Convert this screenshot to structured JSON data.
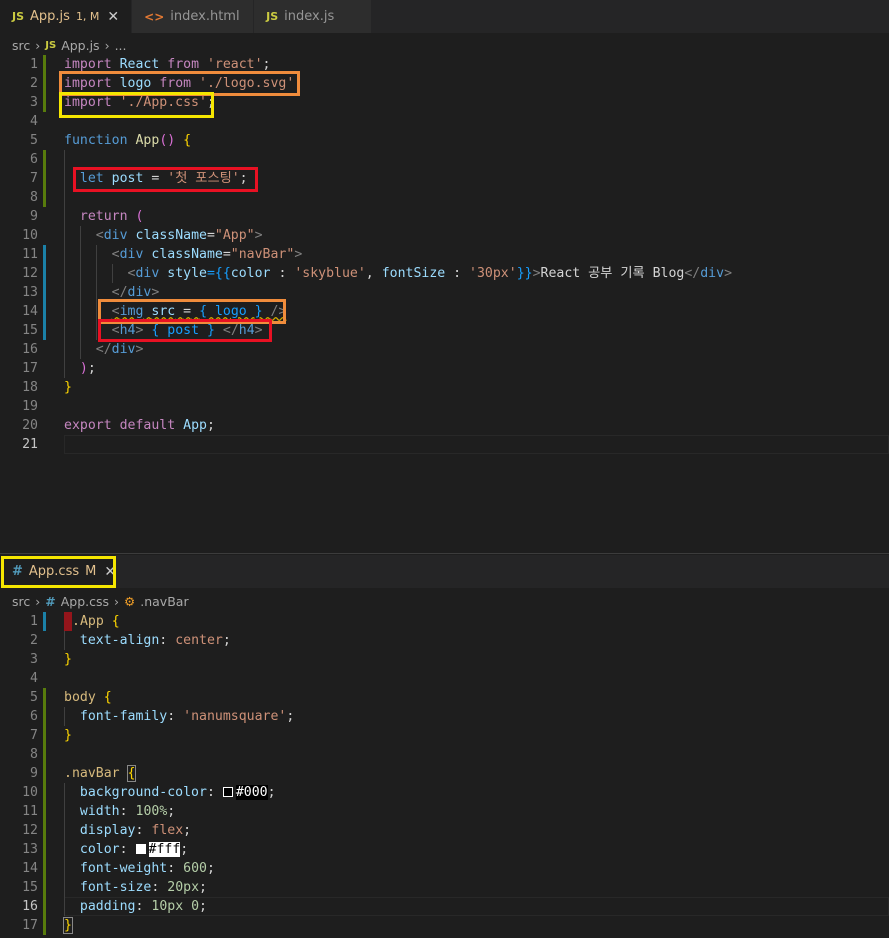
{
  "top_tabs": [
    {
      "icon": "JS",
      "name": "App.js",
      "status": "1, M",
      "active": true
    },
    {
      "icon": "<>",
      "name": "index.html",
      "status": "",
      "active": false
    },
    {
      "icon": "JS",
      "name": "index.js",
      "status": "",
      "active": false
    }
  ],
  "top_breadcrumb": {
    "folder": "src",
    "icon": "JS",
    "file": "App.js",
    "more": "..."
  },
  "top_line_numbers": [
    "1",
    "2",
    "3",
    "4",
    "5",
    "6",
    "7",
    "8",
    "9",
    "10",
    "11",
    "12",
    "13",
    "14",
    "15",
    "16",
    "17",
    "18",
    "19",
    "20",
    "21"
  ],
  "top_code": {
    "l1": [
      "import",
      "React",
      "from",
      "'react'",
      ";"
    ],
    "l2": [
      "import",
      "logo",
      "from",
      "'./logo.svg'",
      ";"
    ],
    "l3": [
      "import",
      "'./App.css'",
      ";"
    ],
    "l5": [
      "function",
      "App",
      "()",
      "{"
    ],
    "l7": [
      "let",
      "post",
      "=",
      "'첫 포스팅'",
      ";"
    ],
    "l9": [
      "return",
      "("
    ],
    "l10": [
      "<",
      "div",
      "className",
      "=",
      "\"App\"",
      ">"
    ],
    "l11": [
      "<",
      "div",
      "className",
      "=",
      "\"navBar\"",
      ">"
    ],
    "l12": [
      "<",
      "div",
      "style",
      "={{",
      "color",
      " : ",
      "'skyblue'",
      ", ",
      "fontSize",
      " : ",
      "'30px'",
      "}}",
      ">",
      "React 공부 기록 Blog",
      "</",
      "div",
      ">"
    ],
    "l13": [
      "</",
      "div",
      ">"
    ],
    "l14": [
      "<",
      "img",
      "src",
      "=",
      "{ logo }",
      "/>"
    ],
    "l15": [
      "<",
      "h4",
      ">",
      "{ post }",
      "</",
      "h4",
      ">"
    ],
    "l16": [
      "</",
      "div",
      ">"
    ],
    "l17": [
      ")",
      ";"
    ],
    "l18": [
      "}"
    ],
    "l20": [
      "export",
      "default",
      "App",
      ";"
    ]
  },
  "bottom_tab": {
    "icon": "#",
    "name": "App.css",
    "status": "M"
  },
  "bottom_breadcrumb": {
    "folder": "src",
    "icon": "#",
    "file": "App.css",
    "symbol": ".navBar"
  },
  "bottom_line_numbers": [
    "1",
    "2",
    "3",
    "4",
    "5",
    "6",
    "7",
    "8",
    "9",
    "10",
    "11",
    "12",
    "13",
    "14",
    "15",
    "16",
    "17"
  ],
  "css_code": {
    "l1": [
      ".App",
      "{"
    ],
    "l2": [
      "text-align",
      ":",
      "center",
      ";"
    ],
    "l3": [
      "}"
    ],
    "l5": [
      "body",
      "{"
    ],
    "l6": [
      "font-family",
      ":",
      "'nanumsquare'",
      ";"
    ],
    "l7": [
      "}"
    ],
    "l9": [
      ".navBar",
      "{"
    ],
    "l10": [
      "background-color",
      ":",
      "#000",
      ";"
    ],
    "l11": [
      "width",
      ":",
      "100%",
      ";"
    ],
    "l12": [
      "display",
      ":",
      "flex",
      ";"
    ],
    "l13": [
      "color",
      ":",
      "#fff",
      ";"
    ],
    "l14": [
      "font-weight",
      ":",
      "600",
      ";"
    ],
    "l15": [
      "font-size",
      ":",
      "20px",
      ";"
    ],
    "l16": [
      "padding",
      ":",
      "10px 0",
      ";"
    ],
    "l17": [
      "}"
    ]
  },
  "colors": {
    "editor_bg": "#1e1e1e",
    "highlight_orange": "#f08c3c",
    "highlight_yellow": "#f5e600",
    "highlight_red": "#e81123"
  }
}
